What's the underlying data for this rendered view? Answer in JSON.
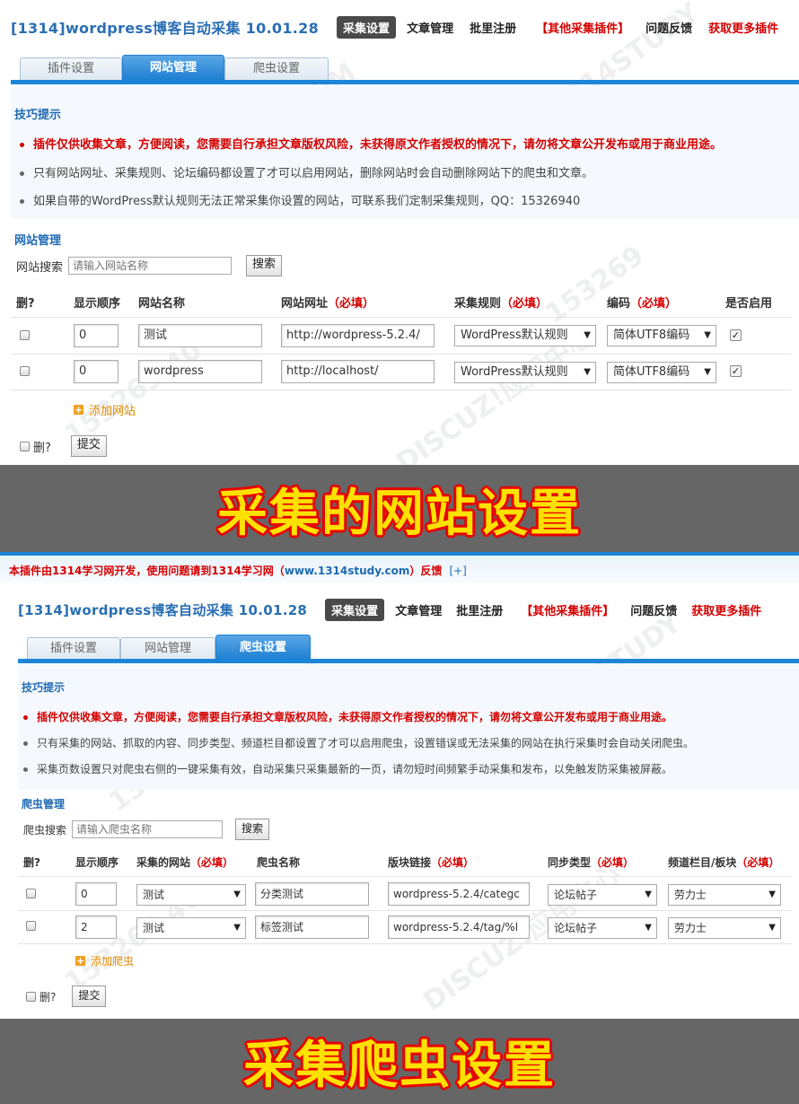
{
  "panel1": {
    "app_title": "[1314]wordpress博客自动采集 10.01.28",
    "nav": [
      "采集设置",
      "文章管理",
      "批里注册",
      "【其他采集插件】",
      "问题反馈",
      "获取更多插件"
    ],
    "tabs": [
      "插件设置",
      "网站管理",
      "爬虫设置"
    ],
    "active_tab": 1,
    "tips_title": "技巧提示",
    "tips": [
      "插件仅供收集文章，方便阅读，您需要自行承担文章版权风险，未获得原文作者授权的情况下，请勿将文章公开发布或用于商业用途。",
      "只有网站网址、采集规则、论坛编码都设置了才可以启用网站，删除网站时会自动删除网站下的爬虫和文章。",
      "如果自带的WordPress默认规则无法正常采集你设置的网站，可联系我们定制采集规则，QQ：15326940"
    ],
    "section_title": "网站管理",
    "search_label": "网站搜索",
    "search_placeholder": "请输入网站名称",
    "search_button": "搜索",
    "headers": {
      "del": "删?",
      "order": "显示顺序",
      "name": "网站名称",
      "url": "网站网址",
      "rule": "采集规则",
      "encoding": "编码",
      "enabled": "是否启用",
      "required": "（必填）"
    },
    "rows": [
      {
        "order": "0",
        "name": "测试",
        "url": "http://wordpress-5.2.4/",
        "rule": "WordPress默认规则",
        "encoding": "简体UTF8编码",
        "enabled": true
      },
      {
        "order": "0",
        "name": "wordpress",
        "url": "http://localhost/",
        "rule": "WordPress默认规则",
        "encoding": "简体UTF8编码",
        "enabled": true
      }
    ],
    "add_label": "添加网站",
    "del_label": "删?",
    "submit_label": "提交"
  },
  "banner1": "采集的网站设置",
  "notice": {
    "prefix": "本插件由1314学习网开发，使用问题请到1314学习网（",
    "domain": "www.1314study.com",
    "suffix": "）反馈",
    "plus": "[+]"
  },
  "panel2": {
    "app_title": "[1314]wordpress博客自动采集 10.01.28",
    "nav": [
      "采集设置",
      "文章管理",
      "批里注册",
      "【其他采集插件】",
      "问题反馈",
      "获取更多插件"
    ],
    "tabs": [
      "插件设置",
      "网站管理",
      "爬虫设置"
    ],
    "active_tab": 2,
    "tips_title": "技巧提示",
    "tips": [
      "插件仅供收集文章，方便阅读，您需要自行承担文章版权风险，未获得原文作者授权的情况下，请勿将文章公开发布或用于商业用途。",
      "只有采集的网站、抓取的内容、同步类型、频道栏目都设置了才可以启用爬虫，设置错误或无法采集的网站在执行采集时会自动关闭爬虫。",
      "采集页数设置只对爬虫右侧的一键采集有效，自动采集只采集最新的一页，请勿短时间频繁手动采集和发布，以免触发防采集被屏蔽。"
    ],
    "section_title": "爬虫管理",
    "search_label": "爬虫搜索",
    "search_placeholder": "请输入爬虫名称",
    "search_button": "搜索",
    "headers": {
      "del": "删?",
      "order": "显示顺序",
      "site": "采集的网站",
      "name": "爬虫名称",
      "link": "版块链接",
      "sync": "同步类型",
      "channel": "频道栏目/板块",
      "required": "（必填）"
    },
    "rows": [
      {
        "order": "0",
        "site": "测试",
        "name": "分类测试",
        "link": "wordpress-5.2.4/categc",
        "sync": "论坛帖子",
        "channel": "劳力士"
      },
      {
        "order": "2",
        "site": "测试",
        "name": "标签测试",
        "link": "wordpress-5.2.4/tag/%l",
        "sync": "论坛帖子",
        "channel": "劳力士"
      }
    ],
    "add_label": "添加爬虫",
    "del_label": "删?",
    "submit_label": "提交"
  },
  "banner2": "采集爬虫设置",
  "icons": {
    "checkbox": "checkbox-icon",
    "check": "check-icon",
    "add": "plus-icon",
    "dropdown": "chevron-down-icon"
  },
  "colors": {
    "accent": "#1b86d8",
    "title_blue": "#2a6fb4",
    "warning_red": "#d40000",
    "banner_gray": "#666666",
    "banner_yellow": "#ffe100"
  }
}
